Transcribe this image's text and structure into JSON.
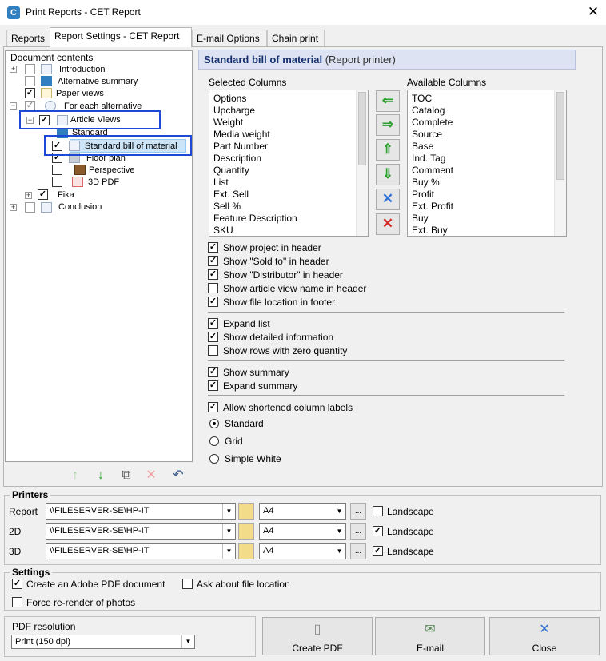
{
  "window": {
    "title": "Print Reports - CET Report",
    "close": "✕",
    "app_icon_letter": "C"
  },
  "tabs": [
    {
      "label": "Reports"
    },
    {
      "label": "Report Settings - CET Report"
    },
    {
      "label": "E-mail Options"
    },
    {
      "label": "Chain print"
    }
  ],
  "tree": {
    "root_label": "Document contents",
    "introduction": "Introduction",
    "alternative_summary": "Alternative summary",
    "paper_views": "Paper views",
    "for_each_alternative": "For each alternative",
    "article_views": "Article Views",
    "standard": "Standard",
    "standard_bom": "Standard bill of material",
    "floor_plan": "Floor plan",
    "perspective": "Perspective",
    "pdf_3d": "3D PDF",
    "fika": "Fika",
    "conclusion": "Conclusion"
  },
  "tree_toolbar": {
    "up": "↑",
    "down": "↓",
    "copy": "⧉",
    "delete": "✕",
    "undo": "↶"
  },
  "header": {
    "title": "Standard bill of material",
    "subtitle": "(Report printer)"
  },
  "columns": {
    "selected_label": "Selected Columns",
    "available_label": "Available Columns",
    "selected": [
      "Options",
      "Upcharge",
      "Weight",
      "Media weight",
      "Part Number",
      "Description",
      "Quantity",
      "List",
      "Ext. Sell",
      "Sell %",
      "Feature Description",
      "SKU"
    ],
    "available": [
      "TOC",
      "Catalog",
      "Complete",
      "Source",
      "Base",
      "Ind. Tag",
      "Comment",
      "Buy %",
      "Profit",
      "Ext. Profit",
      "Buy",
      "Ext. Buy"
    ]
  },
  "move_buttons": {
    "left": "⇐",
    "right": "⇒",
    "up": "⇑",
    "down": "⇓",
    "clear": "✕",
    "remove": "✕"
  },
  "check_mark": "✓",
  "options": {
    "show_project": "Show project in header",
    "show_sold_to": "Show \"Sold to\" in header",
    "show_distributor": "Show \"Distributor\" in header",
    "show_article_view": "Show article view name in header",
    "show_file_location": "Show file location in footer",
    "expand_list": "Expand list",
    "show_detailed": "Show detailed information",
    "show_zero_rows": "Show rows with zero quantity",
    "show_summary": "Show summary",
    "expand_summary": "Expand summary",
    "allow_shortened": "Allow shortened column labels",
    "style_standard": "Standard",
    "style_grid": "Grid",
    "style_simple_white": "Simple White"
  },
  "printers": {
    "group_label": "Printers",
    "rows": [
      {
        "label": "Report",
        "printer": "\\\\FILESERVER-SE\\HP-IT",
        "paper": "A4",
        "landscape_label": "Landscape",
        "landscape": false
      },
      {
        "label": "2D",
        "printer": "\\\\FILESERVER-SE\\HP-IT",
        "paper": "A4",
        "landscape_label": "Landscape",
        "landscape": true
      },
      {
        "label": "3D",
        "printer": "\\\\FILESERVER-SE\\HP-IT",
        "paper": "A4",
        "landscape_label": "Landscape",
        "landscape": true
      }
    ],
    "dropdown_arrow": "▼",
    "dots_button": "..."
  },
  "settings": {
    "group_label": "Settings",
    "create_pdf": "Create an Adobe PDF document",
    "ask_location": "Ask about file location",
    "force_rerender": "Force re-render of photos"
  },
  "pdf_resolution": {
    "label": "PDF resolution",
    "value": "Print (150 dpi)"
  },
  "buttons": {
    "create_pdf": "Create PDF",
    "email": "E-mail",
    "close": "Close"
  }
}
